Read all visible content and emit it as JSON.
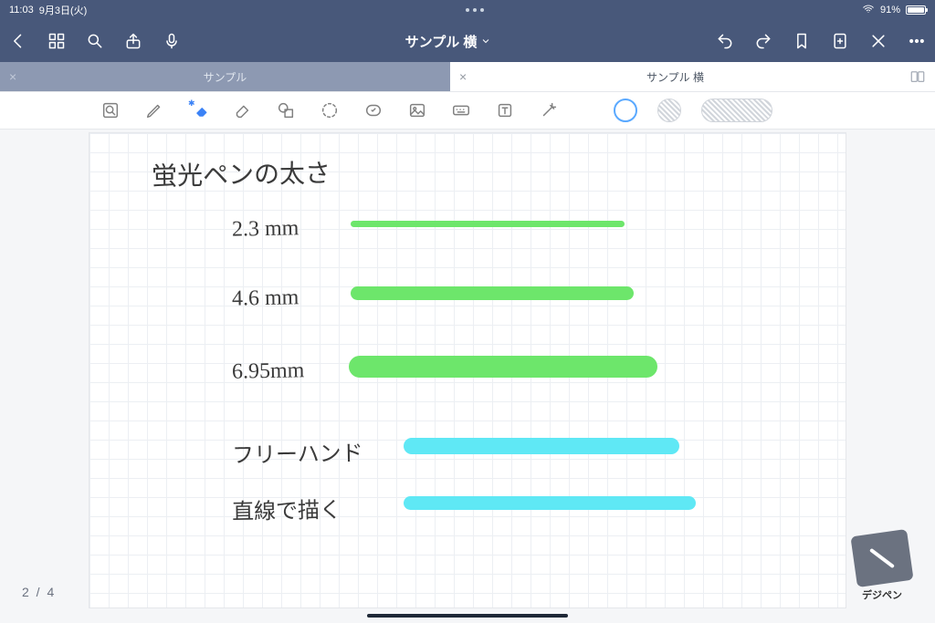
{
  "status": {
    "time": "11:03",
    "date": "9月3日(火)",
    "battery_percent": "91%"
  },
  "nav": {
    "title": "サンプル 横"
  },
  "tabs": {
    "inactive_label": "サンプル",
    "active_label": "サンプル 横"
  },
  "page_counter": "2 / 4",
  "watermark": "デジペン",
  "note": {
    "title": "蛍光ペンの太さ",
    "rows": [
      {
        "label": "2.3 mm"
      },
      {
        "label": "4.6 mm"
      },
      {
        "label": "6.95mm"
      },
      {
        "label": "フリーハンド"
      },
      {
        "label": "直線で描く"
      }
    ]
  },
  "colors": {
    "highlight_green": "#6de66b",
    "highlight_cyan": "#5fe8f5"
  }
}
